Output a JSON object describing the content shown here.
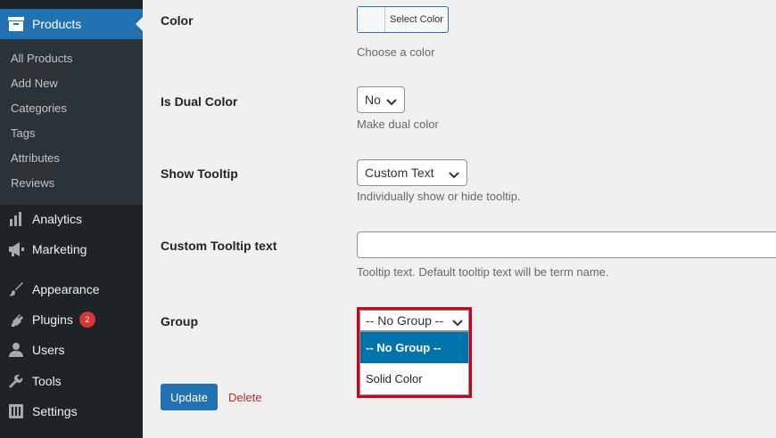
{
  "sidebar": {
    "products_label": "Products",
    "submenu": [
      "All Products",
      "Add New",
      "Categories",
      "Tags",
      "Attributes",
      "Reviews"
    ],
    "items": [
      {
        "label": "Analytics",
        "icon": "bar-chart-icon"
      },
      {
        "label": "Marketing",
        "icon": "megaphone-icon"
      },
      {
        "label": "Appearance",
        "icon": "paintbrush-icon"
      },
      {
        "label": "Plugins",
        "icon": "plugin-icon",
        "badge": "2"
      },
      {
        "label": "Users",
        "icon": "user-icon"
      },
      {
        "label": "Tools",
        "icon": "wrench-icon"
      },
      {
        "label": "Settings",
        "icon": "settings-sliders-icon"
      }
    ],
    "accent_color": "#2271b1",
    "badge_color": "#d63638"
  },
  "form": {
    "color": {
      "label": "Color",
      "button_text": "Select Color",
      "description": "Choose a color"
    },
    "dual_color": {
      "label": "Is Dual Color",
      "value": "No",
      "description": "Make dual color"
    },
    "tooltip": {
      "label": "Show Tooltip",
      "value": "Custom Text",
      "description": "Individually show or hide tooltip."
    },
    "tooltip_text": {
      "label": "Custom Tooltip text",
      "value": "",
      "description": "Tooltip text. Default tooltip text will be term name."
    },
    "group": {
      "label": "Group",
      "value": "-- No Group --",
      "options": [
        "-- No Group --",
        "Solid Color"
      ],
      "highlight_color": "#d0021b"
    },
    "update_label": "Update",
    "delete_label": "Delete"
  }
}
